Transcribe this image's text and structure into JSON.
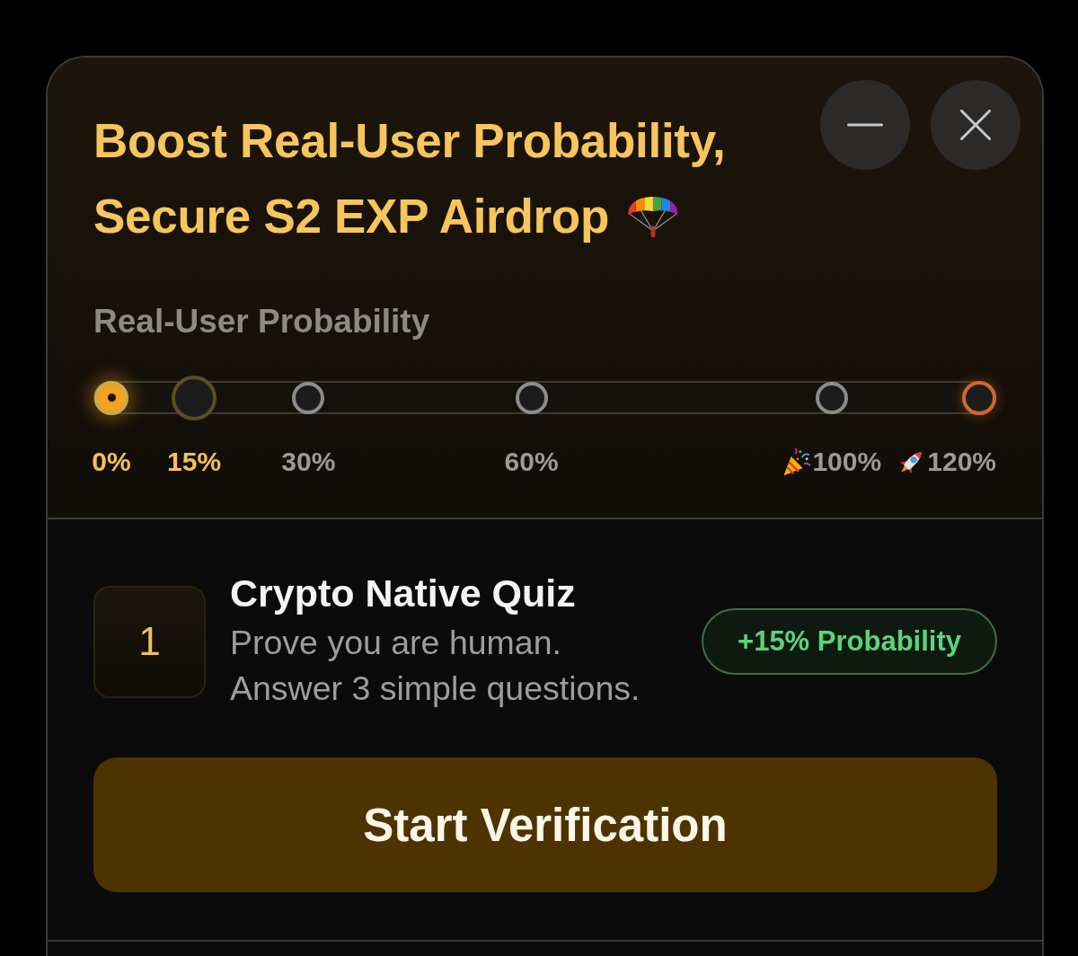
{
  "header": {
    "title_lines": [
      "Boost Real-User Probability,",
      "Secure S2 EXP Airdrop"
    ],
    "window_controls": [
      {
        "kind": "minimize"
      },
      {
        "kind": "close"
      }
    ]
  },
  "probability": {
    "label": "Real-User Probability",
    "milestones": [
      {
        "label": "0%",
        "kind": "current"
      },
      {
        "label": "15%",
        "kind": "target"
      },
      {
        "label": "30%",
        "kind": "step"
      },
      {
        "label": "60%",
        "kind": "step"
      },
      {
        "label": "100%",
        "kind": "goal"
      },
      {
        "label": "120%",
        "kind": "max"
      }
    ]
  },
  "task": {
    "number": "1",
    "title": "Crypto Native Quiz",
    "description": [
      "Prove you are human.",
      "Answer 3 simple questions."
    ],
    "reward": "+15% Probability"
  },
  "primary_button": {
    "label": "Start Verification"
  }
}
